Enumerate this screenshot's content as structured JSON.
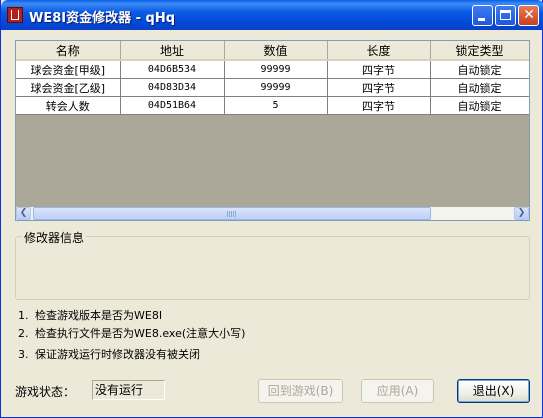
{
  "window": {
    "title": "WE8I资金修改器 - qHq"
  },
  "table": {
    "columns": [
      "名称",
      "地址",
      "数值",
      "长度",
      "锁定类型"
    ],
    "rows": [
      [
        "球会资金[甲级]",
        "04D6B534",
        "99999",
        "四字节",
        "自动锁定"
      ],
      [
        "球会资金[乙级]",
        "04D83D34",
        "99999",
        "四字节",
        "自动锁定"
      ],
      [
        "转会人数",
        "04D51B64",
        "5",
        "四字节",
        "自动锁定"
      ]
    ]
  },
  "info_group": {
    "label": "修改器信息"
  },
  "notes": [
    {
      "num": "1.",
      "text": "检查游戏版本是否为WE8I"
    },
    {
      "num": "2.",
      "text": "检查执行文件是否为WE8.exe(注意大小写)"
    },
    {
      "num": "3.",
      "text": "保证游戏运行时修改器没有被关闭"
    }
  ],
  "status": {
    "label": "游戏状态：",
    "value": "没有运行"
  },
  "buttons": {
    "back": "回到游戏(B)",
    "apply": "应用(A)",
    "exit": "退出(X)"
  }
}
